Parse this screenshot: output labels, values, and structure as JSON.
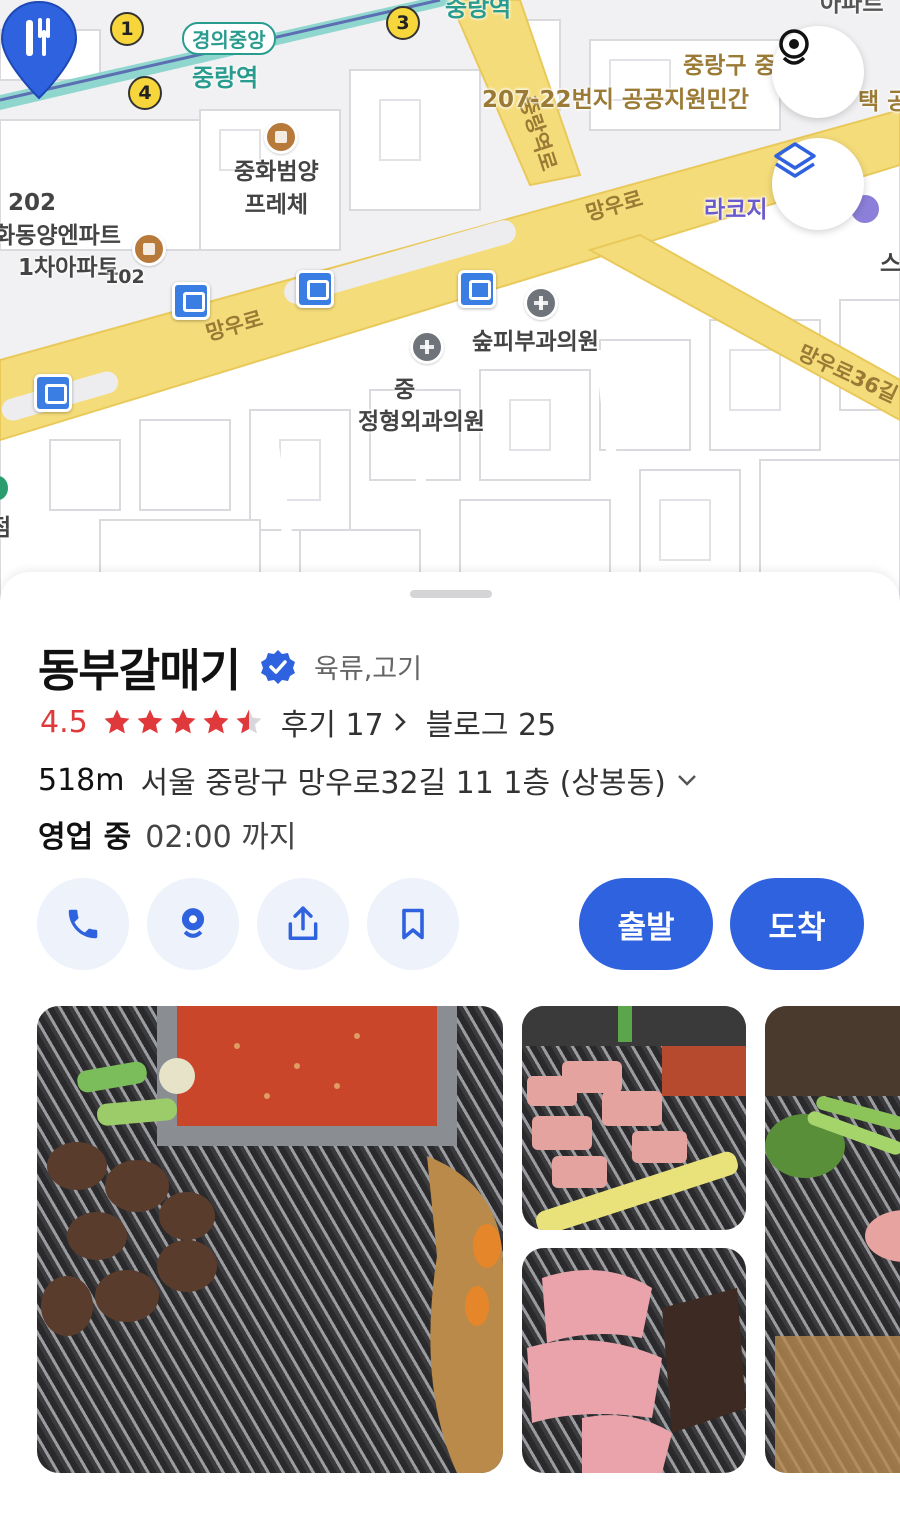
{
  "map": {
    "labels": {
      "station_line_name": "경의중앙",
      "station_name": "중랑역",
      "station_name_top": "중랑역",
      "poi_hwabeom": "중화범양\n프레체",
      "apt_202": "202",
      "apt_dongyang": "화동양엔파트",
      "apt_1cha": "1차아파트",
      "apt_102": "102",
      "road_mangu_1": "망우로",
      "road_mangu_2": "망우로",
      "road_mangu36": "망우로36길",
      "road_jungrang": "중랑역로",
      "landmark_207": "207-22번지 공공지원민간",
      "landmark_jungrang_gu": "중랑구 중",
      "landmark_taek": "택 공",
      "poi_lakoji": "라코지",
      "poi_skin": "숲피부과의원",
      "poi_ortho_1": "중",
      "poi_ortho_2": "정형외과의원",
      "poi_left_branch": "점",
      "top_right_apt": "아파트",
      "right_edge": "스"
    },
    "line_badges": [
      "1",
      "4",
      "3"
    ],
    "buttons": {
      "street_view_icon": "street-view-icon",
      "layers_icon": "layers-icon"
    },
    "colors": {
      "road_main": "#f5dc7a",
      "road_edge": "#e9c95a",
      "block": "#ffffff",
      "block_stroke": "#d9d9de",
      "rail": "#8fd6cf",
      "pin": "#2f62de"
    }
  },
  "place": {
    "name": "동부갈매기",
    "verified_icon": "verified-badge-icon",
    "category": "육류,고기",
    "rating": "4.5",
    "stars": 4.5,
    "reviews_label": "후기 17",
    "blog_label": "블로그 25",
    "distance": "518m",
    "address": "서울 중랑구 망우로32길 11 1층 (상봉동)",
    "open_status": "영업 중",
    "hours": "02:00 까지"
  },
  "actions": {
    "call_icon": "phone-icon",
    "streetview_icon": "street-view-icon",
    "share_icon": "share-icon",
    "save_icon": "bookmark-icon",
    "depart_label": "출발",
    "arrive_label": "도착"
  },
  "colors": {
    "accent": "#2f62de",
    "rating": "#e0393b",
    "button_bg": "#eef2fb"
  }
}
